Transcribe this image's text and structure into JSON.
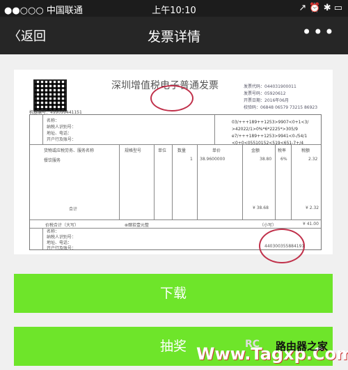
{
  "status": {
    "carrier": "●●○○○ 中国联通",
    "time": "上午10:10",
    "icons": "↗ ⏰ ✱ ▭"
  },
  "nav": {
    "back": "返回",
    "title": "发票详情",
    "more": "•••"
  },
  "invoice": {
    "title": "深圳增值税电子普通发票",
    "machine_no": "机器编号：499099441151",
    "meta": [
      "发票代码：044031900011",
      "发票号码：05920612",
      "开票日期：2016年06月",
      "校验码：06848 06579 73215 86923"
    ],
    "code": [
      "03/+++189++1253>9907<0+1<3/",
      ">42022/1>0%*6*2225*>305/9",
      "e7/+++189++1253>9941<0-/54/1",
      "<0+0<05510152<519<651-7+/4"
    ],
    "buyer_labels": [
      "名称：",
      "纳税人识别号：",
      "地址、电话：",
      "开户行及账号："
    ],
    "header": [
      "货物或应税劳务、服务名称",
      "规格型号",
      "单位",
      "数量",
      "单价",
      "金额",
      "税率",
      "税额"
    ],
    "row": {
      "name": "餐饮服务",
      "unit": "",
      "qty": "1",
      "price": "38.9600000",
      "amount": "38.80",
      "rate": "6%",
      "tax": "2.32"
    },
    "total_label": "合计",
    "total_amount": "¥ 38.68",
    "total_tax": "¥ 2.32",
    "grand_label": "价税合计（大写）",
    "grand_words": "⊗肆拾壹元整",
    "grand_small": "（小写）",
    "grand_value": "¥ 41.00",
    "seller_labels": [
      "名称：",
      "纳税人识别号：",
      "地址、电话：",
      "开户行及账号："
    ],
    "seal_text": "440300355884191"
  },
  "buttons": {
    "download": "下载",
    "lottery": "抽奖"
  },
  "watermarks": [
    "Www.Tagxp.Com",
    "路由器之家",
    "RC"
  ]
}
